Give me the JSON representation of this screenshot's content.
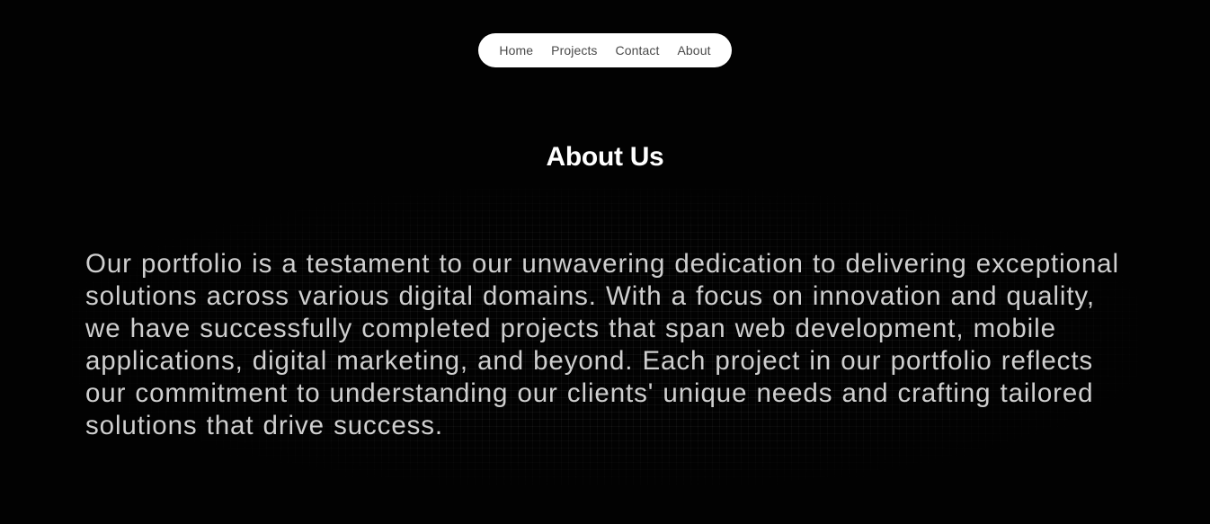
{
  "nav": {
    "items": [
      "Home",
      "Projects",
      "Contact",
      "About"
    ]
  },
  "about": {
    "title": "About Us",
    "body": "Our portfolio is a testament to our unwavering dedication to delivering exceptional solutions across various digital domains. With a focus on innovation and quality, we have successfully completed projects that span web development, mobile applications, digital marketing, and beyond. Each project in our portfolio reflects our commitment to understanding our clients' unique needs and crafting tailored solutions that drive success."
  },
  "colors": {
    "background": "#020202",
    "nav_background": "#ffffff",
    "nav_text": "#4a4a4a",
    "title": "#ffffff",
    "body_text": "#cfcfcf"
  }
}
